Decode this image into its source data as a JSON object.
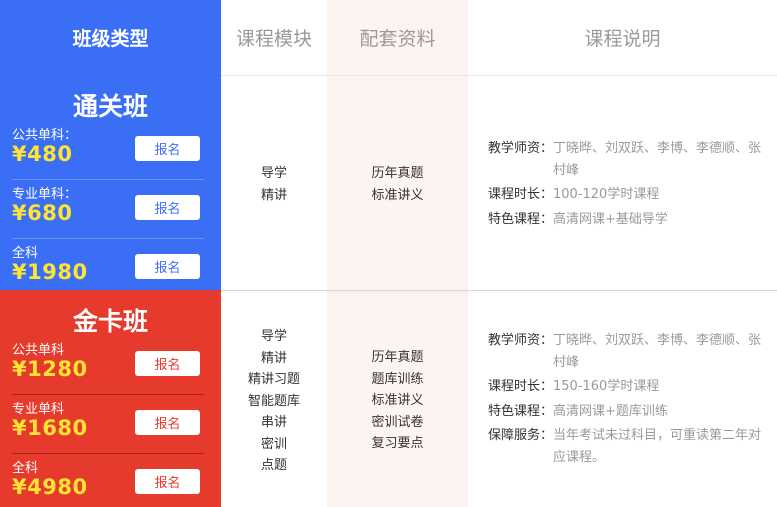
{
  "header": {
    "col1": "班级类型",
    "col2": "课程模块",
    "col3": "配套资料",
    "col4": "课程说明"
  },
  "classes": [
    {
      "title": "通关班",
      "rows": [
        {
          "label": "公共单科：",
          "price": "¥480",
          "button": "报名"
        },
        {
          "label": "专业单科：",
          "price": "¥680",
          "button": "报名"
        },
        {
          "label": "全科",
          "price": "¥1980",
          "button": "报名"
        }
      ],
      "modules": [
        "导学",
        "精讲"
      ],
      "materials": [
        "历年真题",
        "标准讲义"
      ],
      "description": [
        {
          "label": "教学师资：",
          "value": "丁晓晔、刘双跃、李博、李德顺、张村峰"
        },
        {
          "label": "课程时长：",
          "value": "100-120学时课程"
        },
        {
          "label": "特色课程：",
          "value": "高清网课+基础导学"
        }
      ]
    },
    {
      "title": "金卡班",
      "rows": [
        {
          "label": "公共单科",
          "price": "¥1280",
          "button": "报名"
        },
        {
          "label": "专业单科",
          "price": "¥1680",
          "button": "报名"
        },
        {
          "label": "全科",
          "price": "¥4980",
          "button": "报名"
        }
      ],
      "modules": [
        "导学",
        "精讲",
        "精讲习题",
        "智能题库",
        "串讲",
        "密训",
        "点题"
      ],
      "materials": [
        "历年真题",
        "题库训练",
        "标准讲义",
        "密训试卷",
        "复习要点"
      ],
      "description": [
        {
          "label": "教学师资：",
          "value": "丁晓晔、刘双跃、李博、李德顺、张村峰"
        },
        {
          "label": "课程时长：",
          "value": "150-160学时课程"
        },
        {
          "label": "特色课程：",
          "value": "高清网课+题库训练"
        },
        {
          "label": "保障服务：",
          "value": "当年考试未过科目，可重读第二年对应课程。"
        }
      ]
    }
  ]
}
